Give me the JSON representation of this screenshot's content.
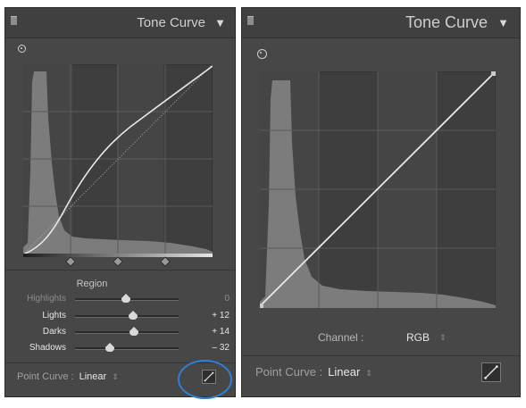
{
  "left_panel": {
    "title": "Tone Curve",
    "region_label": "Region",
    "sliders": [
      {
        "label": "Highlights",
        "value": "0",
        "position": 0.49,
        "active": false
      },
      {
        "label": "Lights",
        "value": "+ 12",
        "position": 0.56,
        "active": true
      },
      {
        "label": "Darks",
        "value": "+ 14",
        "position": 0.57,
        "active": true
      },
      {
        "label": "Shadows",
        "value": "– 32",
        "position": 0.34,
        "active": true
      }
    ],
    "point_curve_label": "Point Curve :",
    "point_curve_value": "Linear"
  },
  "right_panel": {
    "title": "Tone Curve",
    "channel_label": "Channel :",
    "channel_value": "RGB",
    "point_curve_label": "Point Curve :",
    "point_curve_value": "Linear"
  },
  "icons": {
    "collapse": "triangle-down-icon",
    "targeted_adjustment": "target-icon",
    "edit_point_curve": "curve-edit-icon",
    "stepper": "up-down-stepper-icon"
  },
  "colors": {
    "panel_bg": "#474747",
    "graph_bg": "#3e3e3e",
    "histogram": "#7c7c7c",
    "curve": "#e8e8e8",
    "highlight_ring": "#2f7fd6"
  }
}
